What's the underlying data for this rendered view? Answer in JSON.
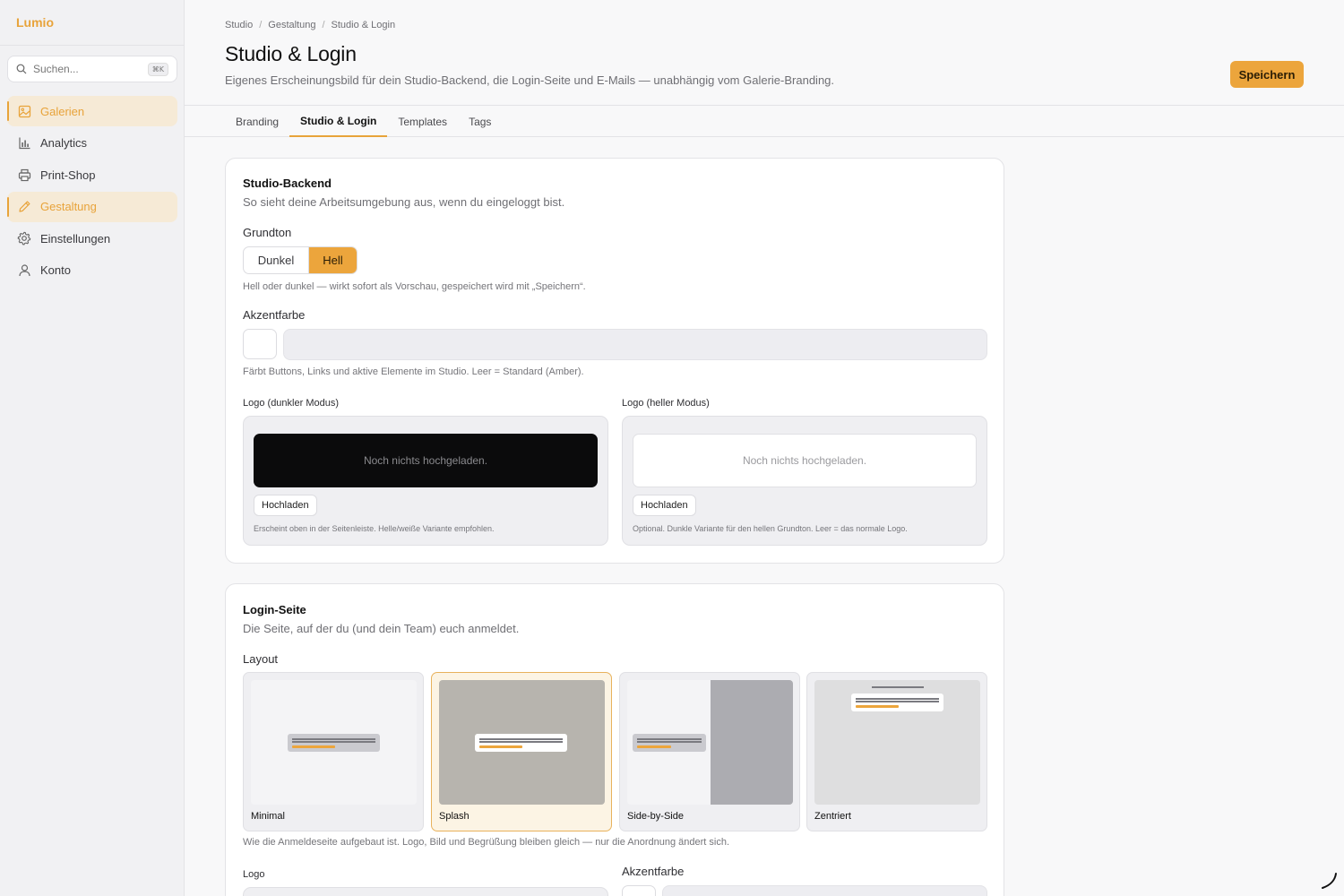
{
  "app": {
    "name": "Lumio"
  },
  "search": {
    "placeholder": "Suchen...",
    "shortcut": "⌘K"
  },
  "sidebar": {
    "items": [
      {
        "label": "Galerien",
        "icon": "image-icon",
        "active": true
      },
      {
        "label": "Analytics",
        "icon": "bar-chart-icon",
        "active": false
      },
      {
        "label": "Print-Shop",
        "icon": "printer-icon",
        "active": false
      },
      {
        "label": "Gestaltung",
        "icon": "pencil-icon",
        "active": true
      },
      {
        "label": "Einstellungen",
        "icon": "gear-icon",
        "active": false
      },
      {
        "label": "Konto",
        "icon": "user-icon",
        "active": false
      }
    ]
  },
  "breadcrumb": [
    "Studio",
    "Gestaltung",
    "Studio & Login"
  ],
  "page": {
    "title": "Studio & Login",
    "subtitle": "Eigenes Erscheinungsbild für dein Studio-Backend, die Login-Seite und E-Mails — unabhängig vom Galerie-Branding.",
    "save_label": "Speichern"
  },
  "tabs": [
    {
      "label": "Branding",
      "active": false
    },
    {
      "label": "Studio & Login",
      "active": true
    },
    {
      "label": "Templates",
      "active": false
    },
    {
      "label": "Tags",
      "active": false
    }
  ],
  "studio_backend": {
    "title": "Studio-Backend",
    "subtitle": "So sieht deine Arbeitsumgebung aus, wenn du eingeloggt bist.",
    "tone_label": "Grundton",
    "tone_options": [
      "Dunkel",
      "Hell"
    ],
    "tone_selected": "Hell",
    "tone_hint": "Hell oder dunkel — wirkt sofort als Vorschau, gespeichert wird mit „Speichern“.",
    "accent_label": "Akzentfarbe",
    "accent_value": "",
    "accent_hint": "Färbt Buttons, Links und aktive Elemente im Studio. Leer = Standard (Amber).",
    "logo_dark": {
      "label": "Logo (dunkler Modus)",
      "empty": "Noch nichts hochgeladen.",
      "upload": "Hochladen",
      "hint": "Erscheint oben in der Seitenleiste. Helle/weiße Variante empfohlen."
    },
    "logo_light": {
      "label": "Logo (heller Modus)",
      "empty": "Noch nichts hochgeladen.",
      "upload": "Hochladen",
      "hint": "Optional. Dunkle Variante für den hellen Grundton. Leer = das normale Logo."
    }
  },
  "login_page": {
    "title": "Login-Seite",
    "subtitle": "Die Seite, auf der du (und dein Team) euch anmeldet.",
    "layout_label": "Layout",
    "layouts": [
      "Minimal",
      "Splash",
      "Side-by-Side",
      "Zentriert"
    ],
    "layout_selected": "Splash",
    "layout_hint": "Wie die Anmeldeseite aufgebaut ist. Logo, Bild und Begrüßung bleiben gleich — nur die Anordnung ändert sich.",
    "logo_label": "Logo",
    "accent_label": "Akzentfarbe"
  },
  "colors": {
    "accent": "#eca53c",
    "accent_text": "#e8a33a",
    "active_bg": "#f6ead6"
  }
}
